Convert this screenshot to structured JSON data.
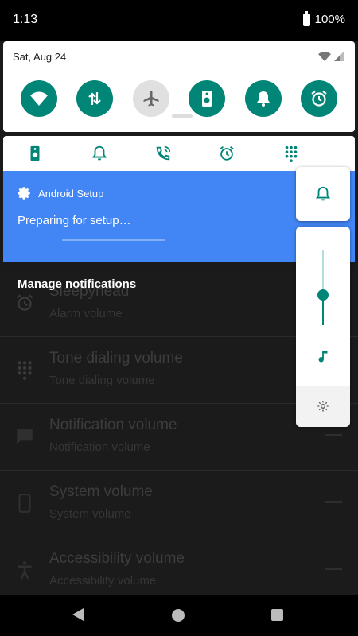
{
  "status_bar": {
    "time": "1:13",
    "battery": "100%"
  },
  "quick_settings": {
    "date": "Sat, Aug 24",
    "tiles": [
      {
        "name": "wifi-icon",
        "state": "on"
      },
      {
        "name": "data-transfer-icon",
        "state": "on"
      },
      {
        "name": "airplane-icon",
        "state": "off"
      },
      {
        "name": "speaker-icon",
        "state": "on"
      },
      {
        "name": "bell-icon",
        "state": "on"
      },
      {
        "name": "alarm-icon",
        "state": "on"
      }
    ]
  },
  "volume_streams": [
    "speaker-icon",
    "bell-icon",
    "phone-ring-icon",
    "alarm-icon",
    "dialpad-icon"
  ],
  "notification": {
    "app_name": "Android Setup",
    "title": "Preparing for setup…",
    "color": "#4285f4"
  },
  "manage_notifications": "Manage notifications",
  "settings_list": [
    {
      "title": "Sleepyhead",
      "subtitle": "Alarm volume",
      "icon": "alarm-icon"
    },
    {
      "title": "Tone dialing volume",
      "subtitle": "Tone dialing volume",
      "icon": "dialpad-icon"
    },
    {
      "title": "Notification volume",
      "subtitle": "Notification volume",
      "icon": "message-icon"
    },
    {
      "title": "System volume",
      "subtitle": "System volume",
      "icon": "phone-icon"
    },
    {
      "title": "Accessibility volume",
      "subtitle": "Accessibility volume",
      "icon": "accessibility-icon"
    }
  ],
  "volume_dialog": {
    "level": 0.4,
    "accent": "#008577"
  },
  "accent_color": "#008577"
}
